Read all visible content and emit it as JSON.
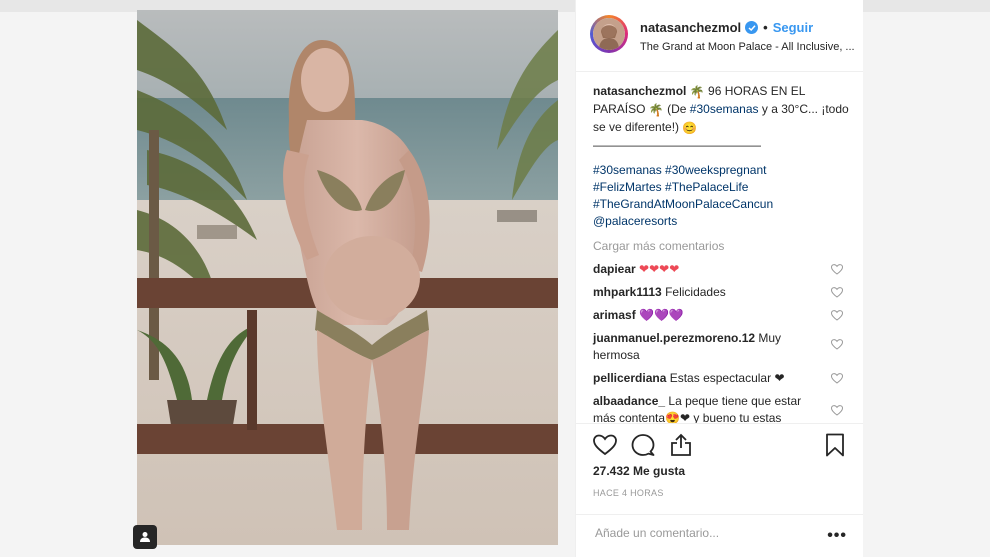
{
  "post": {
    "username": "natasanchezmol",
    "follow_label": "Seguir",
    "location": "The Grand at Moon Palace - All Inclusive, ...",
    "caption": {
      "text_1": "96 HORAS EN EL PARAÍSO",
      "text_2": "(De",
      "tag_1": "#30semanas",
      "text_3": "y a 30°C... ¡todo se ve diferente!)",
      "divider": "——————————————",
      "hashtags": [
        "#30semanas #30weekspregnant",
        "#FelizMartes #ThePalaceLife",
        "#TheGrandAtMoonPalaceCancun",
        "@palaceresorts"
      ]
    },
    "load_more_label": "Cargar más comentarios",
    "comments": [
      {
        "user": "dapiear",
        "text": "❤❤❤❤"
      },
      {
        "user": "mhpark1113",
        "text": "Felicidades"
      },
      {
        "user": "arimasf",
        "text": "💜💜💜"
      },
      {
        "user": "juanmanuel.perezmoreno.12",
        "text": "Muy hermosa"
      },
      {
        "user": "pellicerdiana",
        "text": "Estas espectacular ❤"
      },
      {
        "user": "albaadance_",
        "text": "La peque tiene que estar más contenta😍❤ y bueno tu estas preciosa😊"
      }
    ],
    "likes": "27.432 Me gusta",
    "timestamp": "HACE 4 HORAS",
    "comment_placeholder": "Añade un comentario...",
    "more_label": "•••"
  },
  "icons": {
    "verified": "verified-badge-icon",
    "heart": "heart-icon",
    "comment": "comment-icon",
    "share": "share-icon",
    "bookmark": "bookmark-icon",
    "user_tag": "user-tag-icon",
    "palm": "palm-tree-emoji",
    "smile": "smile-emoji"
  },
  "colors": {
    "link": "#3897f0",
    "hashtag": "#003569",
    "heart_red": "#ed4956",
    "heart_purple": "#8a63d2",
    "muted": "#999999"
  }
}
